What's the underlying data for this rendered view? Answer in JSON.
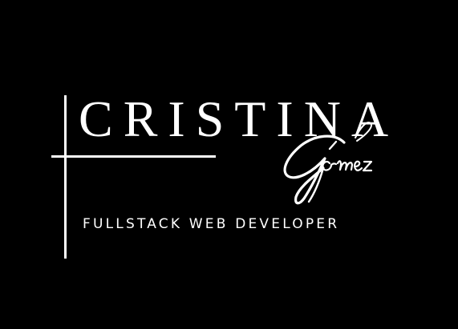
{
  "logo": {
    "first_name": "CRISTINA",
    "last_name": "Gómez",
    "role": "FULLSTACK WEB DEVELOPER"
  },
  "colors": {
    "background": "#000000",
    "foreground": "#ffffff"
  }
}
